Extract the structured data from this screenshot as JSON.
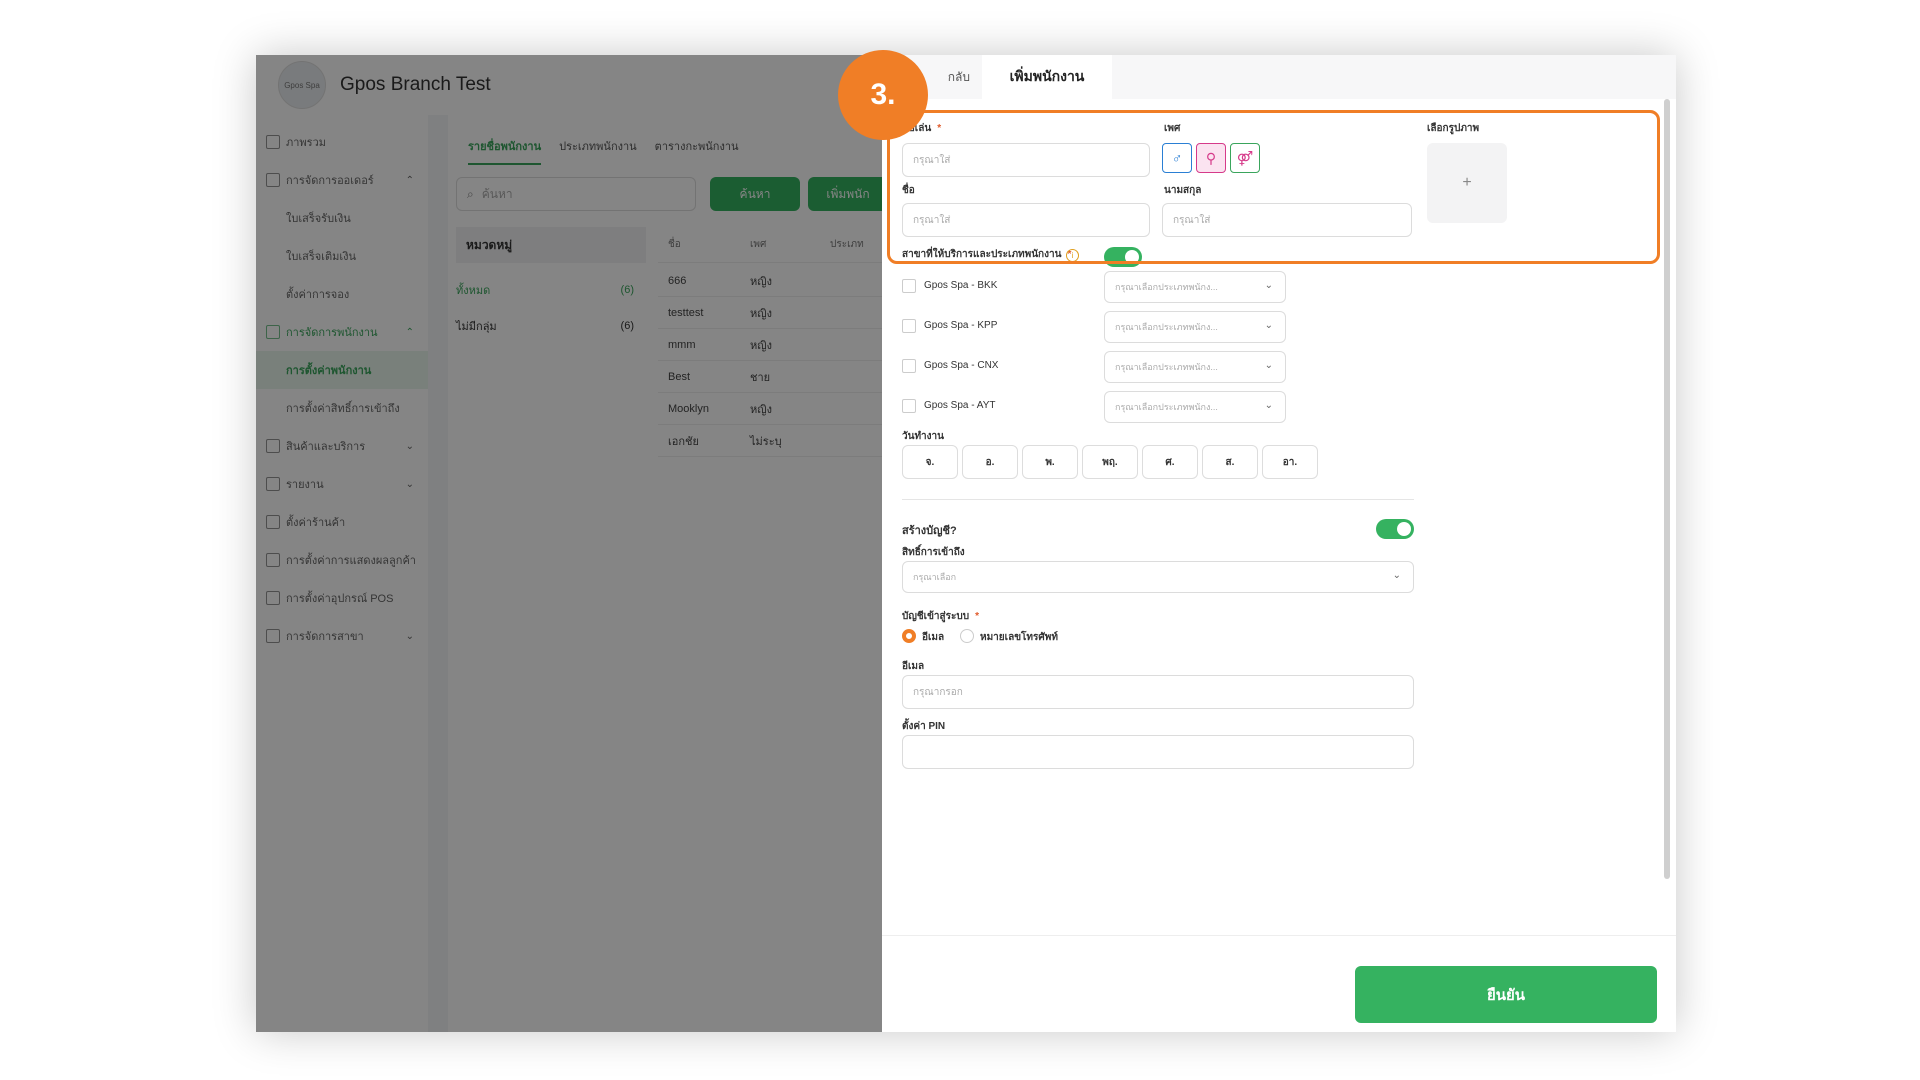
{
  "app": {
    "logo_text": "Gpos Spa",
    "branch_title": "Gpos Branch Test"
  },
  "sidebar": {
    "items": [
      {
        "label": "ภาพรวม",
        "type": "parent"
      },
      {
        "label": "การจัดการออเดอร์",
        "type": "parent",
        "chevron": "up"
      },
      {
        "label": "ใบเสร็จรับเงิน",
        "type": "sub"
      },
      {
        "label": "ใบเสร็จเติมเงิน",
        "type": "sub"
      },
      {
        "label": "ตั้งค่าการจอง",
        "type": "sub"
      },
      {
        "label": "การจัดการพนักงาน",
        "type": "parent",
        "chevron": "up",
        "active": true
      },
      {
        "label": "การตั้งค่าพนักงาน",
        "type": "sub",
        "active": true
      },
      {
        "label": "การตั้งค่าสิทธิ์การเข้าถึง",
        "type": "sub"
      },
      {
        "label": "สินค้าและบริการ",
        "type": "parent",
        "chevron": "down"
      },
      {
        "label": "รายงาน",
        "type": "parent",
        "chevron": "down"
      },
      {
        "label": "ตั้งค่าร้านค้า",
        "type": "parent"
      },
      {
        "label": "การตั้งค่าการแสดงผลลูกค้า",
        "type": "parent"
      },
      {
        "label": "การตั้งค่าอุปกรณ์ POS",
        "type": "parent"
      },
      {
        "label": "การจัดการสาขา",
        "type": "parent",
        "chevron": "down"
      }
    ]
  },
  "content": {
    "tabs": [
      "รายชื่อพนักงาน",
      "ประเภทพนักงาน",
      "ตารางกะพนักงาน"
    ],
    "search_placeholder": "ค้นหา",
    "search_button": "ค้นหา",
    "add_button": "เพิ่มพนัก",
    "category_header": "หมวดหมู่",
    "categories": [
      {
        "name": "ทั้งหมด",
        "count": "(6)"
      },
      {
        "name": "ไม่มีกลุ่ม",
        "count": "(6)"
      }
    ],
    "table_headers": [
      "ชื่อ",
      "เพศ",
      "ประเภท"
    ],
    "rows": [
      [
        "666",
        "หญิง"
      ],
      [
        "testtest",
        "หญิง"
      ],
      [
        "mmm",
        "หญิง"
      ],
      [
        "Best",
        "ชาย"
      ],
      [
        "Mooklyn",
        "หญิง"
      ],
      [
        "เอกชัย",
        "ไม่ระบุ"
      ]
    ]
  },
  "drawer": {
    "back_label": "กลับ",
    "title": "เพิ่มพนักงาน",
    "nickname_label": "ชื่อเล่น",
    "required_mark": "*",
    "nickname_placeholder": "กรุณาใส่",
    "gender_label": "เพศ",
    "photo_label": "เลือกรูปภาพ",
    "photo_plus": "+",
    "firstname_label": "ชื่อ",
    "firstname_placeholder": "กรุณาใส่",
    "lastname_label": "นามสกุล",
    "lastname_placeholder": "กรุณาใส่",
    "branch_service_label": "สาขาที่ให้บริการและประเภทพนักงาน",
    "info_icon": "i",
    "branches": [
      {
        "name": "Gpos Spa - BKK",
        "placeholder": "กรุณาเลือกประเภทพนักง..."
      },
      {
        "name": "Gpos Spa - KPP",
        "placeholder": "กรุณาเลือกประเภทพนักง..."
      },
      {
        "name": "Gpos Spa - CNX",
        "placeholder": "กรุณาเลือกประเภทพนักง..."
      },
      {
        "name": "Gpos Spa - AYT",
        "placeholder": "กรุณาเลือกประเภทพนักง..."
      }
    ],
    "workday_label": "วันทำงาน",
    "days": [
      "จ.",
      "อ.",
      "พ.",
      "พฤ.",
      "ศ.",
      "ส.",
      "อา."
    ],
    "create_account_label": "สร้างบัญชี?",
    "access_label": "สิทธิ์การเข้าถึง",
    "access_placeholder": "กรุณาเลือก",
    "login_label": "บัญชีเข้าสู่ระบบ",
    "login_options": [
      "อีเมล",
      "หมายเลขโทรศัพท์"
    ],
    "email_label": "อีเมล",
    "email_placeholder": "กรุณากรอก",
    "pin_label": "ตั้งค่า PIN",
    "confirm_button": "ยืนยัน"
  },
  "annotation": {
    "step": "3."
  },
  "colors": {
    "accent_green": "#35b260",
    "highlight_orange": "#f07e26",
    "male": "#2a7fd4",
    "female": "#d63a8a",
    "other": "#3aa55c"
  },
  "icons": {
    "male": "male-icon",
    "female": "female-icon",
    "other": "other-gender-icon"
  }
}
